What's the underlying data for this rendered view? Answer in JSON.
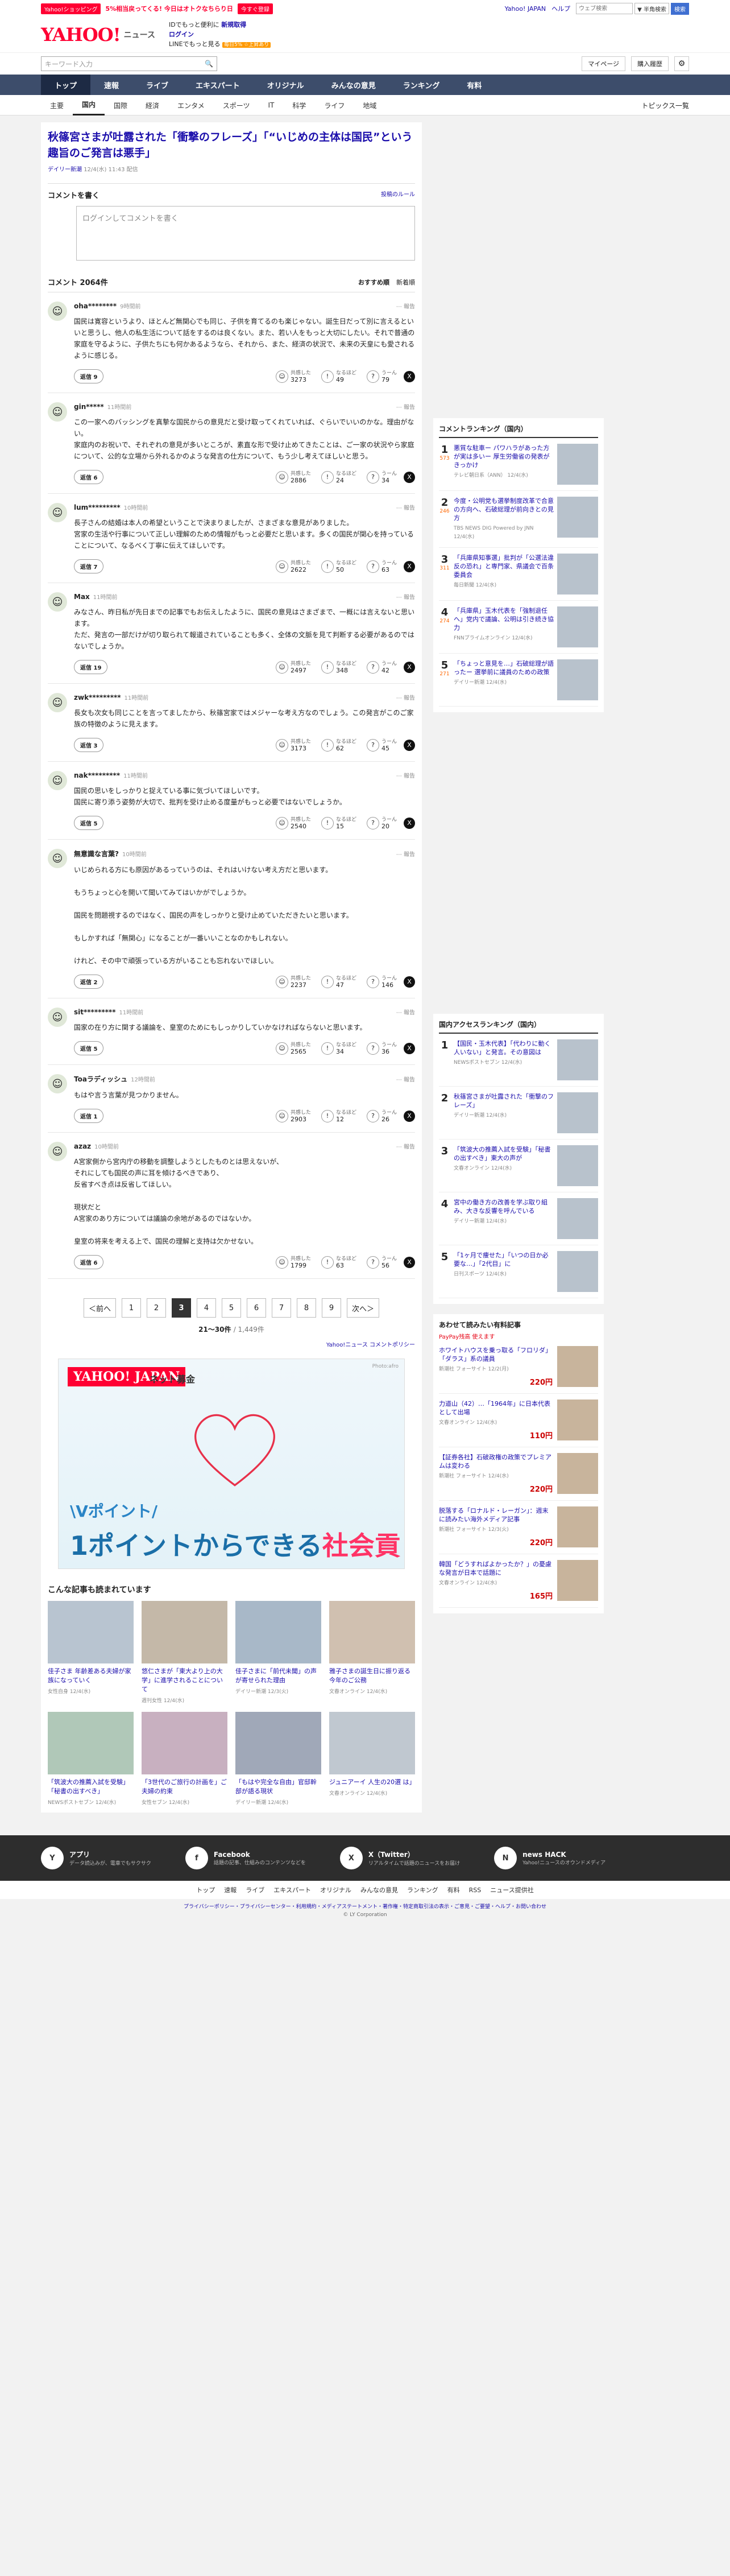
{
  "topbar": {
    "promo_tag": "Yahoo!ショッピング",
    "promo": "5%相当戻ってくる! 今日はオトクなちらり日",
    "notice": "今すぐ登録",
    "links": [
      "Yahoo! JAPAN",
      "ヘルプ"
    ],
    "search_placeholder": "ウェブ検索",
    "search_sel": "▼ 半角検索",
    "search_btn": "検索"
  },
  "header": {
    "logo": "YAHOO!",
    "sub": "ニュース",
    "msg1": "IDでもっと便利に",
    "msg1b": "新規取得",
    "msg2": "ログイン",
    "msg3": "LINEでもっと見る",
    "msg3b": "毎日5% ☆上昇あり"
  },
  "search": {
    "placeholder": "キーワード入力",
    "mypage": "マイページ",
    "buy": "購入履歴"
  },
  "gnav": [
    "トップ",
    "速報",
    "ライブ",
    "エキスパート",
    "オリジナル",
    "みんなの意見",
    "ランキング",
    "有料"
  ],
  "cnav": [
    "主要",
    "国内",
    "国際",
    "経済",
    "エンタメ",
    "スポーツ",
    "IT",
    "科学",
    "ライフ",
    "地域"
  ],
  "cnav_right": "トピックス一覧",
  "article": {
    "title": "秋篠宮さまが吐露された「衝撃のフレーズ」「“いじめの主体は国民”という趣旨のご発言は悪手」",
    "publisher": "デイリー新潮",
    "date": "12/4(水) 11:43 配信"
  },
  "comment_form": {
    "label": "コメントを書く",
    "policy": "投稿のルール",
    "placeholder": "ログインしてコメントを書く"
  },
  "comments_head": {
    "title": "コメント 2064件",
    "sort1": "おすすめ順",
    "sort2": "新着順"
  },
  "reactions": {
    "a": "共感した",
    "b": "なるほど",
    "c": "うーん",
    "reply": "返信"
  },
  "comments": [
    {
      "name": "oha********",
      "ago": "9時間前",
      "text": "国民は寛容というより、ほとんど無関心でも同じ、子供を育てるのも楽じゃない。誕生日だって別に言えるといいと思うし、他人の私生活について話をするのは良くない。また、若い人をもっと大切にしたい。それで普通の家庭を守るように、子供たちにも何かあるようなら、それから、また、経済の状況で、未来の天皇にも愛されるように感じる。",
      "replies": "返信 9",
      "r1": "3273",
      "r2": "49",
      "r3": "79"
    },
    {
      "name": "gin*****",
      "ago": "11時間前",
      "text": "この一家へのバッシングを真摯な国民からの意見だと受け取ってくれていれば、ぐらいでいいのかな。理由がない。\n家庭内のお祝いで、それぞれの意見が多いところが、素直な形で受け止めてきたことは、ご一家の状況やら家庭について、公的な立場から外れるかのような発言の仕方について、もう少し考えてほしいと思う。",
      "replies": "返信 6",
      "r1": "2886",
      "r2": "24",
      "r3": "34"
    },
    {
      "name": "lum*********",
      "ago": "10時間前",
      "text": "長子さんの結婚は本人の希望ということで決まりましたが、さまざまな意見がありました。\n宮家の生活や行事について正しい理解のための情報がもっと必要だと思います。多くの国民が関心を持っていることについて、なるべく丁寧に伝えてほしいです。",
      "replies": "返信 7",
      "r1": "2622",
      "r2": "50",
      "r3": "63"
    },
    {
      "name": "Max",
      "ago": "11時間前",
      "text": "みなさん、昨日私が先日までの記事でもお伝えしたように、国民の意見はさまざまで、一概には言えないと思います。\nただ、発言の一部だけが切り取られて報道されていることも多く、全体の文脈を見て判断する必要があるのではないでしょうか。",
      "replies": "返信 19",
      "r1": "2497",
      "r2": "348",
      "r3": "42"
    },
    {
      "name": "zwk*********",
      "ago": "11時間前",
      "text": "長女も次女も同じことを言ってましたから、秋篠宮家ではメジャーな考え方なのでしょう。この発言がこのご家族の特徴のように見えます。",
      "replies": "返信 3",
      "r1": "3173",
      "r2": "62",
      "r3": "45"
    },
    {
      "name": "nak*********",
      "ago": "11時間前",
      "text": "国民の思いをしっかりと捉えている事に気づいてほしいです。\n国民に寄り添う姿勢が大切で、批判を受け止める度量がもっと必要ではないでしょうか。",
      "replies": "返信 5",
      "r1": "2540",
      "r2": "15",
      "r3": "20"
    },
    {
      "name": "無意識な言葉?",
      "ago": "10時間前",
      "text": "いじめられる方にも原因があるっていうのは、それはいけない考え方だと思います。\n\nもうちょっと心を開いて聞いてみてはいかがでしょうか。\n\n国民を問題視するのではなく、国民の声をしっかりと受け止めていただきたいと思います。\n\nもしかすれば「無関心」になることが一番いいことなのかもしれない。\n\nけれど、その中で頑張っている方がいることも忘れないでほしい。",
      "replies": "返信 2",
      "r1": "2237",
      "r2": "47",
      "r3": "146"
    },
    {
      "name": "sit*********",
      "ago": "11時間前",
      "text": "国家の在り方に関する議論を、皇室のためにもしっかりしていかなければならないと思います。",
      "replies": "返信 5",
      "r1": "2565",
      "r2": "34",
      "r3": "36"
    },
    {
      "name": "Toaラディッシュ",
      "ago": "12時間前",
      "text": "もはや言う言葉が見つかりません。",
      "replies": "返信 1",
      "r1": "2903",
      "r2": "12",
      "r3": "26"
    },
    {
      "name": "azaz",
      "ago": "10時間前",
      "text": "A宮家側から宮内庁の移動を調整しようとしたものとは思えないが、\nそれにしても国民の声に耳を傾けるべきであり、\n反省すべき点は反省してほしい。\n\n現状だと\nA宮家のあり方については議論の余地があるのではないか。\n\n皇室の将来を考える上で、国民の理解と支持は欠かせない。",
      "replies": "返信 6",
      "r1": "1799",
      "r2": "63",
      "r3": "56"
    }
  ],
  "pager": {
    "prev": "＜前へ",
    "pages": [
      "1",
      "2",
      "3",
      "4",
      "5",
      "6",
      "7",
      "8",
      "9"
    ],
    "current": "3",
    "next": "次へ＞",
    "range": "21〜30件",
    "total": "/ 1,449件"
  },
  "policy_link": "Yahoo!ニュース コメントポリシー",
  "ad": {
    "logo": "YAHOO! JAPAN",
    "logo2": "ネット募金",
    "photo": "Photo:afro",
    "line1": "\\Vポイント/",
    "line2a": "1ポイントからできる",
    "line2b": "社会貢献"
  },
  "more": {
    "title": "こんな記事も読まれています",
    "items": [
      {
        "t": "佳子さま 年齢差ある夫婦が家族になっていく",
        "s": "女性自身 12/4(水)"
      },
      {
        "t": "悠仁さまが「東大より上の大学」に進学されることについて",
        "s": "週刊女性 12/4(水)"
      },
      {
        "t": "佳子さまに「前代未聞」の声が寄せられた理由",
        "s": "デイリー新潮 12/3(火)"
      },
      {
        "t": "雅子さまの誕生日に振り返る今年のご公務",
        "s": "文春オンライン 12/4(水)"
      },
      {
        "t": "「筑波大の推薦入試を受験」「秘書の出すべき」",
        "s": "NEWSポストセブン 12/4(水)"
      },
      {
        "t": "「3世代のご旅行の計画を」ご夫婦の約束",
        "s": "女性セブン 12/4(水)"
      },
      {
        "t": "「もはや完全な自由」官邸幹部が語る現状",
        "s": "デイリー新潮 12/4(水)"
      },
      {
        "t": "ジュニアーイ 人生の20選 は」",
        "s": "文春オンライン 12/4(水)"
      }
    ]
  },
  "ranking": {
    "title": "コメントランキング（国内）",
    "items": [
      {
        "n": "1",
        "c": "573",
        "t": "悪質な駐車ー パワハラがあった方が実は多いー 厚生労働省の発表がきっかけ",
        "s": "テレビ朝日系（ANN） 12/4(水)"
      },
      {
        "n": "2",
        "c": "246",
        "t": "今度・公明党も選挙制度改革で合意の方向へ、石破総理が前向きとの見方",
        "s": "TBS NEWS DIG Powered by JNN 12/4(水)"
      },
      {
        "n": "3",
        "c": "311",
        "t": "「兵庫県知事選」批判が「公選法違反の恐れ」と専門家、県議会で百条委員会",
        "s": "毎日新聞 12/4(水)"
      },
      {
        "n": "4",
        "c": "274",
        "t": "「兵庫県」玉木代表を「強制退任へ」党内で議論、公明は引き続き協力",
        "s": "FNNプライムオンライン 12/4(水)"
      },
      {
        "n": "5",
        "c": "271",
        "t": "「ちょっと意見を…」石破総理が語ったー 選挙前に議員のための政策",
        "s": "デイリー新潮 12/4(水)"
      }
    ]
  },
  "access": {
    "title": "国内アクセスランキング（国内）",
    "items": [
      {
        "n": "1",
        "t": "【国民・玉木代表】「代わりに動く人いない」と発言。その意図は",
        "s": "NEWSポストセブン 12/4(水)"
      },
      {
        "n": "2",
        "t": "秋篠宮さまが吐露された「衝撃のフレーズ」",
        "s": "デイリー新潮 12/4(水)"
      },
      {
        "n": "3",
        "t": "「筑波大の推薦入試を受験」「秘書の出すべき」東大の声が",
        "s": "文春オンライン 12/4(水)"
      },
      {
        "n": "4",
        "t": "宮中の働き方の改善を学ぶ取り組み、大きな反響を呼んでいる",
        "s": "デイリー新潮 12/4(水)"
      },
      {
        "n": "5",
        "t": "「1ヶ月で痩せた」「いつの日か必要な…」「2代目」に",
        "s": "日刊スポーツ 12/4(水)"
      }
    ]
  },
  "paypay": {
    "title": "あわせて読みたい有料記事",
    "brand": "PayPay残高 使えます",
    "items": [
      {
        "t": "ホワイトハウスを乗っ取る「フロリダ」「ダラス」系の議員",
        "s": "新潮社 フォーサイト 12/2(月)",
        "p": "220円"
      },
      {
        "t": "力道山（42）…「1964年」に日本代表として出場",
        "s": "文春オンライン 12/4(水)",
        "p": "110円"
      },
      {
        "t": "【証券各社】石破政権の政策でプレミアムは変わる",
        "s": "新潮社 フォーサイト 12/4(水)",
        "p": "220円"
      },
      {
        "t": "脱落する「ロナルド・レーガン」：週末に読みたい海外メディア記事",
        "s": "新潮社 フォーサイト 12/3(火)",
        "p": "220円"
      },
      {
        "t": "韓国「どうすればよかったか？」の憂慮な発言が日本で話題に",
        "s": "文春オンライン 12/4(水)",
        "p": "165円"
      }
    ]
  },
  "footer": {
    "apps": [
      {
        "t": "アプリ",
        "s": "データ読込みが、電車でもサクサク"
      },
      {
        "t": "Facebook",
        "s": "話題の記事、仕組みのコンテンツなどを"
      },
      {
        "t": "X（Twitter）",
        "s": "リアルタイムで話題のニュースをお届け"
      },
      {
        "t": "news HACK",
        "s": "Yahoo!ニュースのオウンドメディア"
      }
    ],
    "nav": [
      "トップ",
      "速報",
      "ライブ",
      "エキスパート",
      "オリジナル",
      "みんなの意見",
      "ランキング",
      "有料",
      "RSS",
      "ニュース提供社"
    ],
    "links": "プライバシーポリシー・プライバシーセンター・利用規約・メディアステートメント・著作権・特定商取引法の表示・ご意見・ご要望・ヘルプ・お問い合わせ",
    "copy": "© LY Corporation"
  }
}
